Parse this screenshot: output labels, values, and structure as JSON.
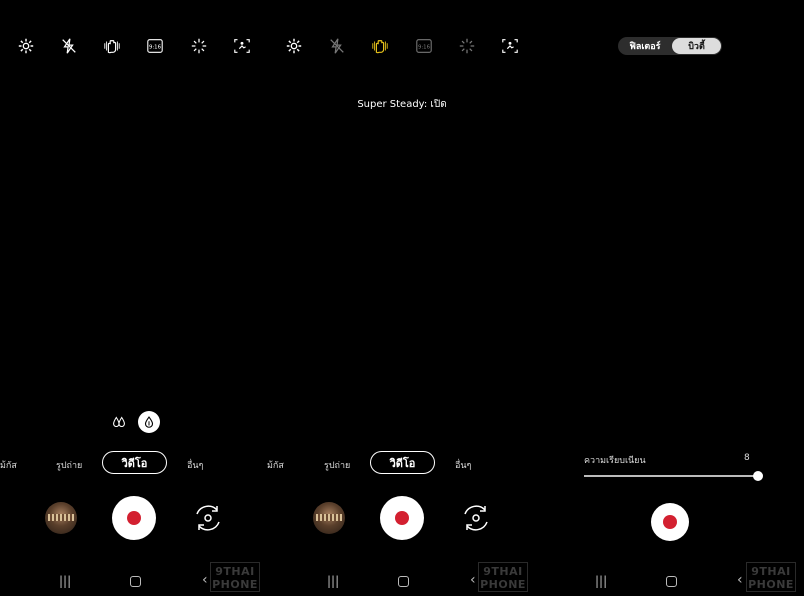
{
  "top_toolbar_left": {
    "icons": [
      "settings-icon",
      "flash-off-icon",
      "super-steady-icon",
      "aspect-ratio-icon",
      "effects-icon",
      "motion-icon"
    ],
    "aspect_label": "9:16"
  },
  "top_toolbar_middle": {
    "icons": [
      "settings-icon",
      "flash-off-icon",
      "super-steady-icon",
      "aspect-ratio-icon",
      "effects-icon",
      "motion-icon"
    ],
    "aspect_label": "9:16",
    "super_steady_active_color": "#e8c31a"
  },
  "toggle": {
    "left": "ฟิลเตอร์",
    "right": "บิวตี้"
  },
  "toast": "Super Steady: เปิด",
  "stabilizer_buttons": [
    "stabilizer-off-icon",
    "stabilizer-on-icon"
  ],
  "mode_bar_1": {
    "focus": "ม้กัส",
    "photo": "รูปถ่าย",
    "video": "วิดีโอ",
    "more": "อื่นๆ"
  },
  "mode_bar_2": {
    "focus": "ม้กัส",
    "photo": "รูปถ่าย",
    "video": "วิดีโอ",
    "more": "อื่นๆ"
  },
  "smoothness": {
    "label": "ความเรียบเนียน",
    "value": "8",
    "level": 1.0
  },
  "watermark": {
    "line1": "9THAI",
    "line2": "PHONE"
  },
  "accent_record_color": "#d32030"
}
